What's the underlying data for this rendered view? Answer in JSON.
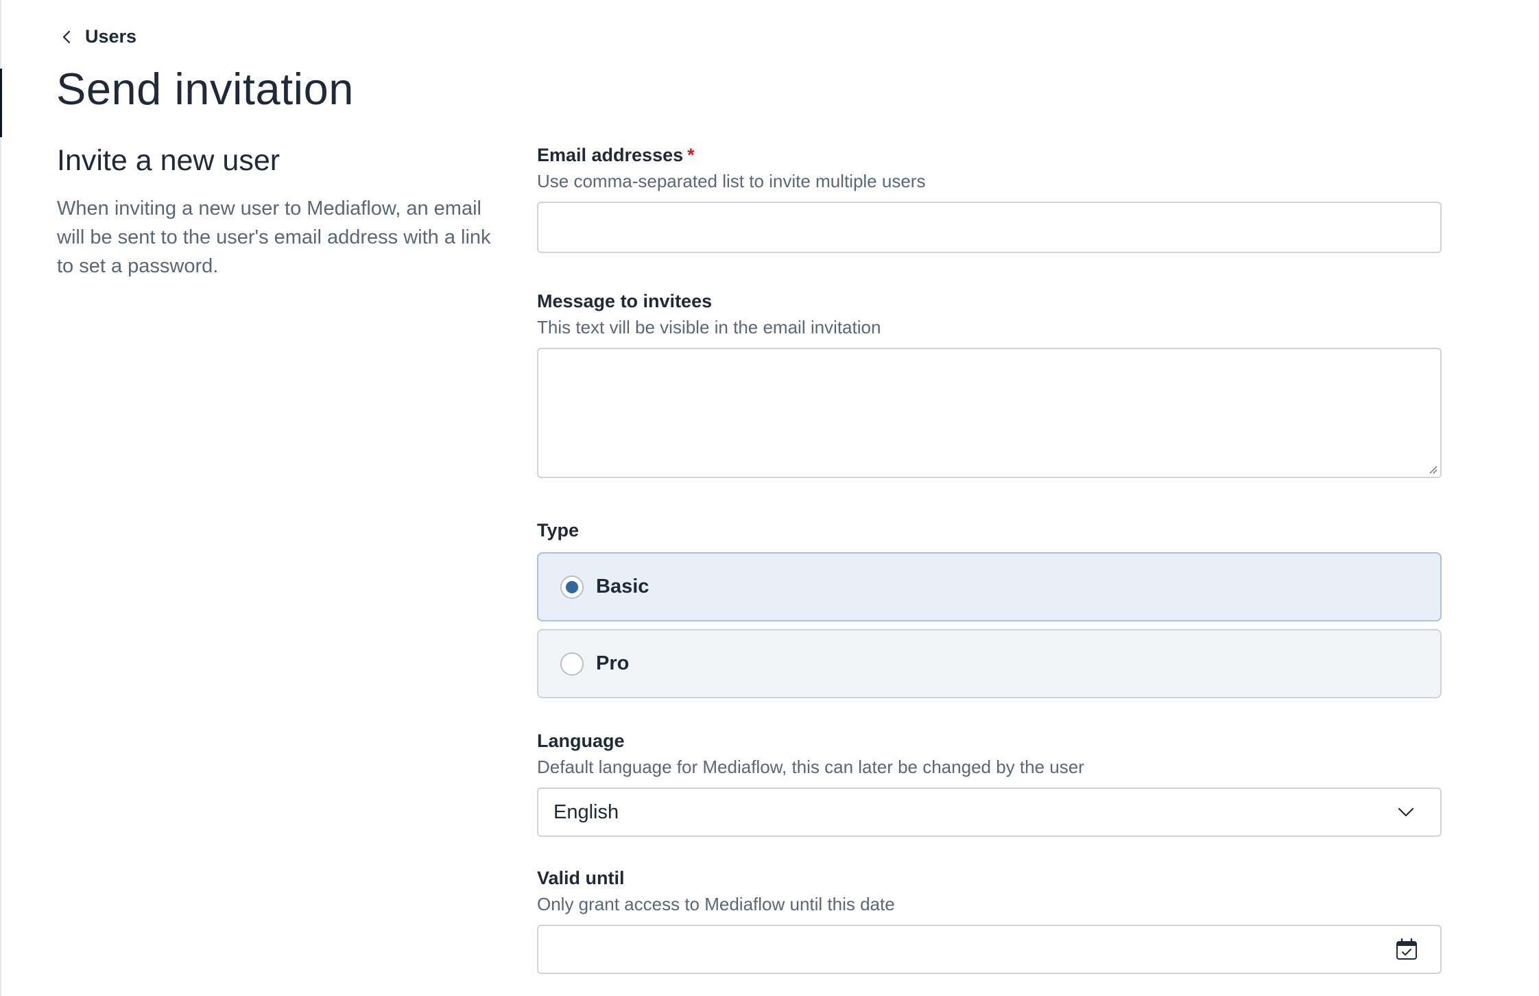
{
  "breadcrumb": {
    "back_label": "Users"
  },
  "page": {
    "title": "Send invitation"
  },
  "intro": {
    "heading": "Invite a new user",
    "description": "When inviting a new user to Mediaflow, an email will be sent to the user's email address with a link to set a password."
  },
  "form": {
    "email": {
      "label": "Email addresses",
      "required_marker": "*",
      "hint": "Use comma-separated list to invite multiple users",
      "value": ""
    },
    "message": {
      "label": "Message to invitees",
      "hint": "This text vill be visible in the email invitation",
      "value": ""
    },
    "type": {
      "label": "Type",
      "options": [
        {
          "label": "Basic",
          "selected": true
        },
        {
          "label": "Pro",
          "selected": false
        }
      ]
    },
    "language": {
      "label": "Language",
      "hint": "Default language for Mediaflow, this can later be changed by the user",
      "selected": "English"
    },
    "valid_until": {
      "label": "Valid until",
      "hint": "Only grant access to Mediaflow until this date",
      "value": ""
    }
  },
  "colors": {
    "accent": "#2e6a9e",
    "required": "#c81e1e",
    "muted_text": "#5a6778",
    "selected_card_bg": "#e8eff6",
    "card_bg": "#f1f3f6"
  },
  "icons": {
    "back": "chevron-left-icon",
    "dropdown": "chevron-down-icon",
    "calendar": "calendar-icon",
    "resize": "resize-handle-icon"
  }
}
